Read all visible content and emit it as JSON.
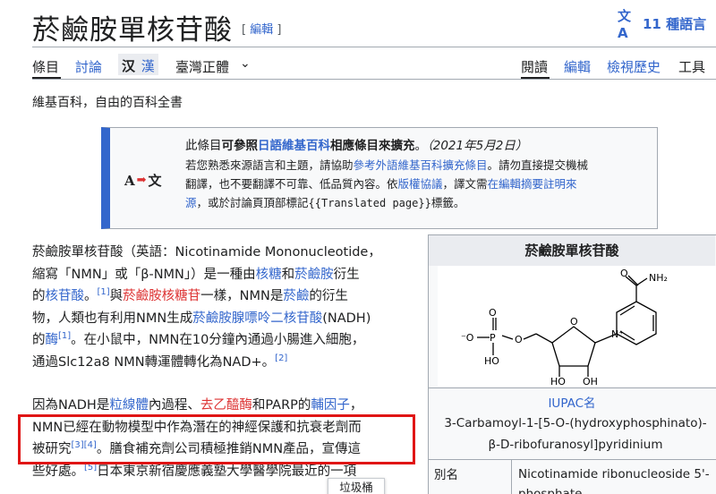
{
  "header": {
    "title": "菸鹼胺單核苷酸",
    "edit_open": "[",
    "edit_label": "編輯",
    "edit_close": "]",
    "lang_icon": "文A",
    "lang_label": "11 種語言"
  },
  "tabs": {
    "article": "條目",
    "talk": "討論",
    "variant_simp": "汉",
    "variant_trad": "漢",
    "variant_tw": "臺灣正體",
    "chevron": "⌄",
    "read": "閱讀",
    "edit": "編輯",
    "history": "檢視歷史",
    "tools": "工具"
  },
  "tagline": "維基百科，自由的百科全書",
  "ambox": {
    "icon_left": "A",
    "icon_arrow": "➡",
    "icon_right": "文",
    "l1_a": "此條目",
    "l1_b": "可參照",
    "l1_c": "日語維基百科",
    "l1_d": "相應條目來擴充",
    "l1_e": "。",
    "l1_date": "（2021年5月2日）",
    "l2_a": "若您熟悉來源語言和主題，請協助",
    "l2_b": "參考外語維基百科擴充條目",
    "l2_c": "。請勿直接提交機械",
    "l3_a": "翻譯，也不要翻譯不可靠、低品質內容。依",
    "l3_b": "版權協議",
    "l3_c": "，譯文需",
    "l3_d": "在編輯摘要註明來",
    "l4_a": "源",
    "l4_b": "，或於討論頁頂部標記",
    "l4_c": "{{Translated page}}",
    "l4_d": "標籤。"
  },
  "para1": {
    "l1": "菸鹼胺單核苷酸（英語：Nicotinamide Mononucleotide，",
    "l2_a": "縮寫「NMN」或「β-NMN」）是一種由",
    "l2_b": "核糖",
    "l2_c": "和",
    "l2_d": "菸鹼胺",
    "l2_e": "衍生",
    "l3_a": "的",
    "l3_b": "核苷酸",
    "l3_c": "。",
    "l3_ref": "[1]",
    "l3_d": "與",
    "l3_e": "菸鹼胺核糖苷",
    "l3_f": "一樣，NMN是",
    "l3_g": "菸鹼",
    "l3_h": "的衍生",
    "l4_a": "物，人類也有利用NMN生成",
    "l4_b": "菸鹼胺腺嘌呤二核苷酸",
    "l4_c": "(NADH)",
    "l5_a": "的",
    "l5_b": "酶",
    "l5_ref": "[1]",
    "l5_c": "。在小鼠中，NMN在10分鐘內通過小腸進入細胞，",
    "l6_a": "通過Slc12a8 NMN轉運體轉化為NAD+。",
    "l6_ref": "[2]"
  },
  "para2": {
    "l1_a": "因為NADH是",
    "l1_b": "粒線體",
    "l1_c": "內過程、",
    "l1_d": "去乙醯酶",
    "l1_e": "和PARP的",
    "l1_f": "輔因子",
    "l1_g": "，",
    "l2": "NMN已經在動物模型中作為潛在的神經保護和抗衰老劑而",
    "l3_a": "被研究",
    "l3_ref1": "[3]",
    "l3_ref2": "[4]",
    "l3_b": "。膳食補充劑公司積極推銷NMN產品，宣傳這",
    "l4_a": "些好處。",
    "l4_ref": "[5]",
    "l4_b": "日本東京新宿慶應義塾大學醫學院最近的一項"
  },
  "infobox": {
    "title": "菸鹼胺單核苷酸",
    "iupac_label": "IUPAC名",
    "iupac_l1": "3-Carbamoyl-1-[5-O-(hydroxyphosphinato)-",
    "iupac_l2": "β-D-ribofuranosyl]pyridinium",
    "alias_label": "別名",
    "alias_l1": "Nicotinamide ribonucleoside 5'-",
    "alias_l2": "phosphate",
    "structure_labels": {
      "o_top": "O",
      "nh2": "NH₂",
      "o_p_top": "O",
      "o_minus": "⁻O",
      "p": "P",
      "o_link": "O",
      "ring_o": "O",
      "n_plus": "N⁺",
      "ho_p": "HO",
      "ho1": "HO",
      "oh2": "OH"
    }
  },
  "tooltip": "垃圾桶",
  "colors": {
    "link": "#3366cc",
    "redlink": "#dd3333",
    "ambox_accent": "#3366cc",
    "highlight": "#e01515"
  }
}
